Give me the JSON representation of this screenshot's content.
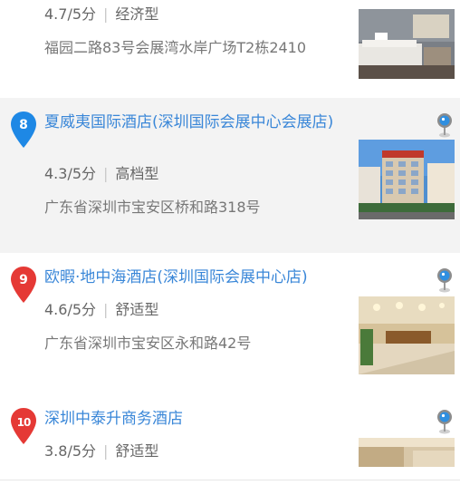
{
  "hotels": [
    {
      "rank": "",
      "name": "",
      "rating": "4.7/5分",
      "type": "经济型",
      "address": "福园二路83号会展湾水岸广场T2栋2410",
      "thumb": "room-photo"
    },
    {
      "rank": "8",
      "name": "夏威夷国际酒店(深圳国际会展中心会展店)",
      "rating": "4.3/5分",
      "type": "高档型",
      "address": "广东省深圳市宝安区桥和路318号",
      "thumb": "building-photo"
    },
    {
      "rank": "9",
      "name": "欧暇·地中海酒店(深圳国际会展中心店)",
      "rating": "4.6/5分",
      "type": "舒适型",
      "address": "广东省深圳市宝安区永和路42号",
      "thumb": "lobby-photo"
    },
    {
      "rank": "10",
      "name": "深圳中泰升商务酒店",
      "rating": "3.8/5分",
      "type": "舒适型",
      "address": "",
      "thumb": "lobby-photo"
    }
  ],
  "colors": {
    "marker_blue": "#1e88e5",
    "marker_red": "#e53935",
    "link_blue": "#3a87d8",
    "highlight_bg": "#f3f3f3"
  },
  "icons": {
    "map_pin": "map-pin-icon",
    "marker": "map-marker-icon"
  }
}
